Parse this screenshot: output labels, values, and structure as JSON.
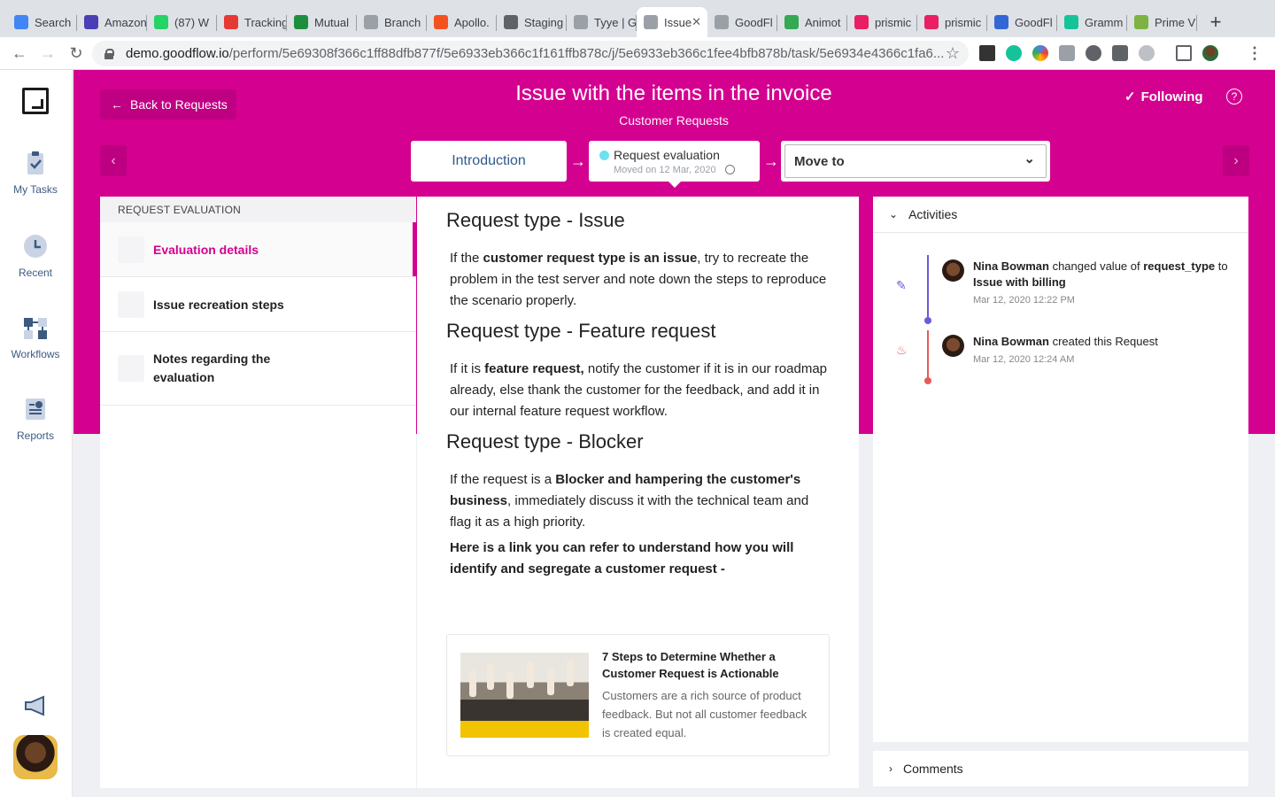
{
  "browser": {
    "tabs": [
      {
        "title": "Search",
        "color": "#4285f4"
      },
      {
        "title": "Amazon",
        "color": "#4b3fb5"
      },
      {
        "title": "(87) W",
        "color": "#25d366"
      },
      {
        "title": "Tracking",
        "color": "#e53935"
      },
      {
        "title": "Mutual",
        "color": "#1e8e3e"
      },
      {
        "title": "Branch",
        "color": "#9aa0a6"
      },
      {
        "title": "Apollo.",
        "color": "#f4511e"
      },
      {
        "title": "Staging",
        "color": "#5f6368"
      },
      {
        "title": "Tyye | G",
        "color": "#9aa0a6"
      },
      {
        "title": "Issue",
        "color": "#9aa0a6"
      },
      {
        "title": "GoodFl",
        "color": "#9aa0a6"
      },
      {
        "title": "Animot",
        "color": "#34a853"
      },
      {
        "title": "prismic",
        "color": "#e91e63"
      },
      {
        "title": "prismic",
        "color": "#e91e63"
      },
      {
        "title": "GoodFl",
        "color": "#3367d6"
      },
      {
        "title": "Gramm",
        "color": "#15c39a"
      },
      {
        "title": "Prime V",
        "color": "#7cb342"
      }
    ],
    "active_tab_index": 9,
    "url_host": "demo.goodflow.io",
    "url_path": "/perform/5e69308f366c1ff88dfb877f/5e6933eb366c1f161ffb878c/j/5e6933eb366c1fee4bfb878b/task/5e6934e4366c1fa6..."
  },
  "sidebar": {
    "items": [
      {
        "label": "My Tasks"
      },
      {
        "label": "Recent"
      },
      {
        "label": "Workflows"
      },
      {
        "label": "Reports"
      }
    ]
  },
  "header": {
    "back_label": "Back to Requests",
    "title": "Issue with the items in the invoice",
    "subtitle": "Customer Requests",
    "following_label": "Following",
    "help": "?"
  },
  "stages": {
    "previous": "Introduction",
    "current": "Request evaluation",
    "current_moved": "Moved on 12 Mar, 2020",
    "move_to_label": "Move to"
  },
  "steps": {
    "header": "REQUEST EVALUATION",
    "items": [
      {
        "label": "Evaluation details"
      },
      {
        "label": "Issue recreation steps"
      },
      {
        "label": "Notes regarding the evaluation"
      }
    ]
  },
  "content": {
    "h1": "Request type - Issue",
    "p1_pre": "If the ",
    "p1_bold": "customer request type is an issue",
    "p1_post": ", try to recreate the problem in the test server and note down the steps to reproduce the scenario properly.",
    "h2": "Request type - Feature request",
    "p2_pre": "If it is ",
    "p2_bold": "feature request,",
    "p2_post": " notify the customer if it is in our roadmap already, else thank the customer for the feedback, and add it in our internal feature request workflow.",
    "h3": "Request type - Blocker",
    "p3_pre": "If the request is a ",
    "p3_bold": "Blocker and hampering the customer's business",
    "p3_post": ", immediately discuss it with the technical team and flag it as a high priority.",
    "p4": "Here is a link you can refer to understand how you will identify and segregate a customer request -",
    "link_title": "7 Steps to Determine Whether a Customer Request is Actionable",
    "link_desc": "Customers are a rich source of product feedback. But not all customer feedback is created equal."
  },
  "activities": {
    "title": "Activities",
    "entries": [
      {
        "user": "Nina Bowman",
        "action": " changed value of ",
        "field": "request_type",
        "connector": " to ",
        "value": "Issue with billing",
        "time": "Mar 12, 2020 12:22 PM",
        "color": "#6b5bd6"
      },
      {
        "user": "Nina Bowman",
        "action": " created this Request",
        "time": "Mar 12, 2020 12:24 AM",
        "color": "#e85a5a"
      }
    ]
  },
  "comments": {
    "title": "Comments"
  }
}
